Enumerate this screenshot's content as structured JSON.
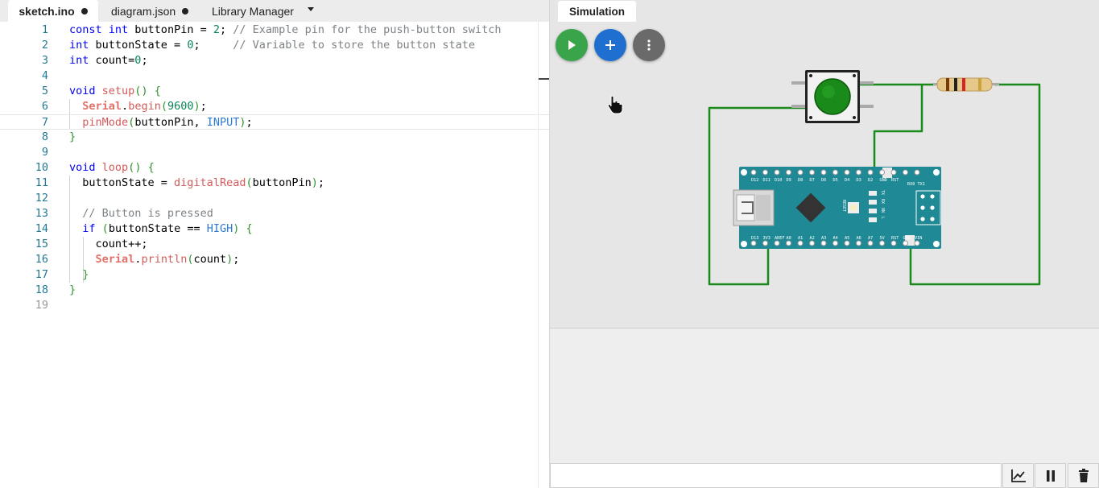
{
  "editor": {
    "tabs": [
      {
        "label": "sketch.ino",
        "unsaved": true,
        "active": true
      },
      {
        "label": "diagram.json",
        "unsaved": true,
        "active": false
      },
      {
        "label": "Library Manager",
        "unsaved": false,
        "active": false
      }
    ],
    "current_line": 7,
    "lines": [
      {
        "n": "1",
        "text": "const int buttonPin = 2; // Example pin for the push-button switch"
      },
      {
        "n": "2",
        "text": "int buttonState = 0;     // Variable to store the button state"
      },
      {
        "n": "3",
        "text": "int count=0;"
      },
      {
        "n": "4",
        "text": ""
      },
      {
        "n": "5",
        "text": "void setup() {"
      },
      {
        "n": "6",
        "text": "  Serial.begin(9600);"
      },
      {
        "n": "7",
        "text": "  pinMode(buttonPin, INPUT);"
      },
      {
        "n": "8",
        "text": "}"
      },
      {
        "n": "9",
        "text": ""
      },
      {
        "n": "10",
        "text": "void loop() {"
      },
      {
        "n": "11",
        "text": "  buttonState = digitalRead(buttonPin);"
      },
      {
        "n": "12",
        "text": ""
      },
      {
        "n": "13",
        "text": "  // Button is pressed"
      },
      {
        "n": "14",
        "text": "  if (buttonState == HIGH) {"
      },
      {
        "n": "15",
        "text": "    count++;"
      },
      {
        "n": "16",
        "text": "    Serial.println(count);"
      },
      {
        "n": "17",
        "text": "  }"
      },
      {
        "n": "18",
        "text": "}"
      },
      {
        "n": "19",
        "text": ""
      }
    ]
  },
  "simulation": {
    "tab_label": "Simulation",
    "icons": {
      "start": "play-icon",
      "add_part": "plus-icon",
      "menu": "more-vertical-icon"
    },
    "colors": {
      "start": "#3aa44a",
      "add_part": "#1f6fd0",
      "menu": "#6a6a6a",
      "wire": "#1a8a1a",
      "board": "#1f8a96",
      "button_cap": "#1a8a1a"
    },
    "board": {
      "top_pin_labels": [
        "D12",
        "D11",
        "D10",
        "D9",
        "D8",
        "D7",
        "D6",
        "D5",
        "D4",
        "D3",
        "D2",
        "GND",
        "RST",
        "RX0",
        "TX1"
      ],
      "bottom_pin_labels": [
        "D13",
        "3V3",
        "AREF",
        "A0",
        "A1",
        "A2",
        "A3",
        "A4",
        "A5",
        "A6",
        "A7",
        "5V",
        "RST",
        "GND",
        "VIN"
      ],
      "led_labels": [
        "TX",
        "RX",
        "ON",
        "L"
      ],
      "reset_label": "RESET"
    }
  },
  "serial_monitor": {
    "input_value": "",
    "icons": {
      "plotter": "chart-line-icon",
      "pause": "pause-icon",
      "clear": "trash-icon"
    }
  }
}
